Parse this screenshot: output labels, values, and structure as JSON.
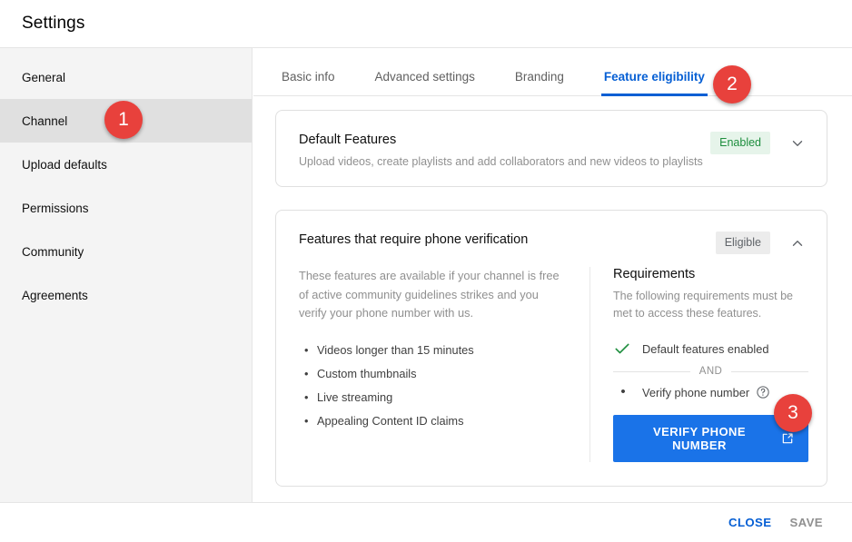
{
  "header": {
    "title": "Settings"
  },
  "sidebar": {
    "items": [
      {
        "label": "General",
        "active": false
      },
      {
        "label": "Channel",
        "active": true
      },
      {
        "label": "Upload defaults",
        "active": false
      },
      {
        "label": "Permissions",
        "active": false
      },
      {
        "label": "Community",
        "active": false
      },
      {
        "label": "Agreements",
        "active": false
      }
    ]
  },
  "tabs": [
    {
      "label": "Basic info",
      "active": false
    },
    {
      "label": "Advanced settings",
      "active": false
    },
    {
      "label": "Branding",
      "active": false
    },
    {
      "label": "Feature eligibility",
      "active": true
    }
  ],
  "cards": {
    "default_features": {
      "title": "Default Features",
      "subtitle": "Upload videos, create playlists and add collaborators and new videos to playlists",
      "status": "Enabled",
      "chevron": "chevron-down-icon"
    },
    "phone_verification": {
      "title": "Features that require phone verification",
      "status": "Eligible",
      "chevron": "chevron-up-icon",
      "description": "These features are available if your channel is free of active community guidelines strikes and you verify your phone number with us.",
      "features": [
        "Videos longer than 15 minutes",
        "Custom thumbnails",
        "Live streaming",
        "Appealing Content ID claims"
      ],
      "requirements": {
        "title": "Requirements",
        "subtitle": "The following requirements must be met to access these features.",
        "met_item": "Default features enabled",
        "separator": "AND",
        "pending_item": "Verify phone number",
        "help_icon": "help-circle-icon",
        "cta_label": "VERIFY PHONE NUMBER",
        "cta_icon": "external-link-icon"
      }
    }
  },
  "footer": {
    "close_label": "CLOSE",
    "save_label": "SAVE"
  },
  "annotations": [
    {
      "number": "1"
    },
    {
      "number": "2"
    },
    {
      "number": "3"
    }
  ],
  "colors": {
    "accent_blue": "#065fd4",
    "button_blue": "#1a73e8",
    "enabled_green": "#1e8e3e",
    "badge_red": "#e8413c"
  }
}
